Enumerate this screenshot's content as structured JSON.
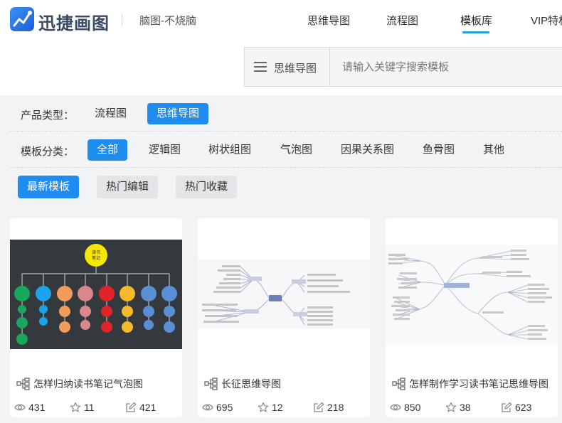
{
  "header": {
    "brand": "迅捷画图",
    "slogan": "脑图-不烧脑",
    "nav": [
      {
        "label": "思维导图"
      },
      {
        "label": "流程图"
      },
      {
        "label": "模板库"
      },
      {
        "label": "VIP特权"
      }
    ],
    "active_nav": "模板库"
  },
  "search": {
    "type_label": "思维导图",
    "placeholder": "请输入关键字搜索模板"
  },
  "filters": {
    "product_label": "产品类型：",
    "products": [
      "流程图",
      "思维导图"
    ],
    "product_selected": "思维导图",
    "category_label": "模板分类：",
    "categories": [
      "全部",
      "逻辑图",
      "树状组图",
      "气泡图",
      "因果关系图",
      "鱼骨图",
      "其他"
    ],
    "category_selected": "全部",
    "sorts": [
      "最新模板",
      "热门编辑",
      "热门收藏"
    ],
    "sort_selected": "最新模板"
  },
  "cards": [
    {
      "title": "怎样归纳读书笔记气泡图",
      "views": "431",
      "stars": "11",
      "edits": "421",
      "center_text_1": "读书",
      "center_text_2": "笔记"
    },
    {
      "title": "长征思维导图",
      "views": "695",
      "stars": "12",
      "edits": "218"
    },
    {
      "title": "怎样制作学习读书笔记思维导图",
      "views": "850",
      "stars": "38",
      "edits": "623"
    }
  ],
  "colors": {
    "accent": "#1f8cf0",
    "nav_underline": "#24a0d8",
    "bubble_bg": "#34393d"
  }
}
